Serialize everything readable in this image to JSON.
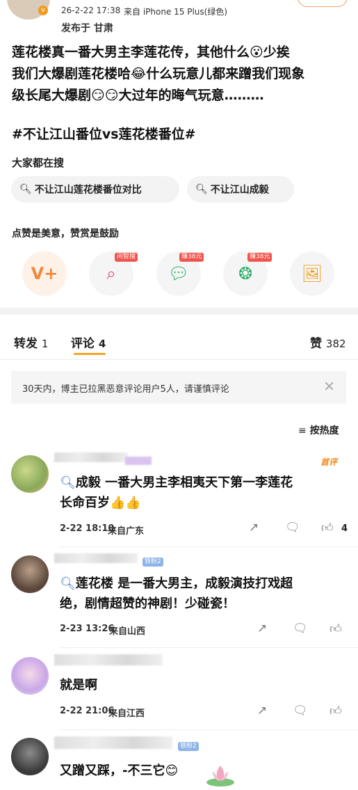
{
  "post": {
    "time": "26-2-22 17:38",
    "source": "来自 iPhone 15 Plus(绿色)",
    "location": "发布于 甘肃",
    "text_line1": "莲花楼真一番大男主李莲花传，其他什么😮少挨",
    "text_line2": "我们大爆剧莲花楼哈😂什么玩意儿都来蹭我们现象",
    "text_line3": "级长尾大爆剧😏😏大过年的晦气玩意………",
    "hashtag": "#不让江山番位vs莲花楼番位#"
  },
  "search": {
    "title": "大家都在搜",
    "chip1": "不让江山莲花楼番位对比",
    "chip2": "不让江山成毅"
  },
  "reward": {
    "title": "点赞是美意，赞赏是鼓励",
    "badge2": "问智搜",
    "badge3": "赚38元",
    "badge4": "赚38元"
  },
  "tabs": {
    "repost_label": "转发",
    "repost_count": "1",
    "comment_label": "评论",
    "comment_count": "4",
    "like_label": "赞",
    "like_count": "382"
  },
  "notice": "30天内，博主已拉黑恶意评论用户5人，请谨慎评论",
  "sort_label": "按热度",
  "comments": [
    {
      "badge": "首评",
      "mention": "成毅",
      "line1": " 一番大男主李相夷天下第一李莲花",
      "line2": "长命百岁👍👍",
      "time": "2-22 18:10",
      "loc": "来自广东",
      "likes": "4"
    },
    {
      "fan_badge": "铁粉2",
      "mention": "莲花楼",
      "line1": " 是一番大男主，成毅演技打戏超",
      "line2": "绝，剧情超赞的神剧！少碰瓷！",
      "time": "2-23 13:26",
      "loc": "来自山西"
    },
    {
      "line1": "就是啊",
      "time": "2-22 21:06",
      "loc": "来自江西"
    },
    {
      "fan_badge": "铁粉2",
      "line1": "又蹭又踩，-不三它😊"
    }
  ]
}
